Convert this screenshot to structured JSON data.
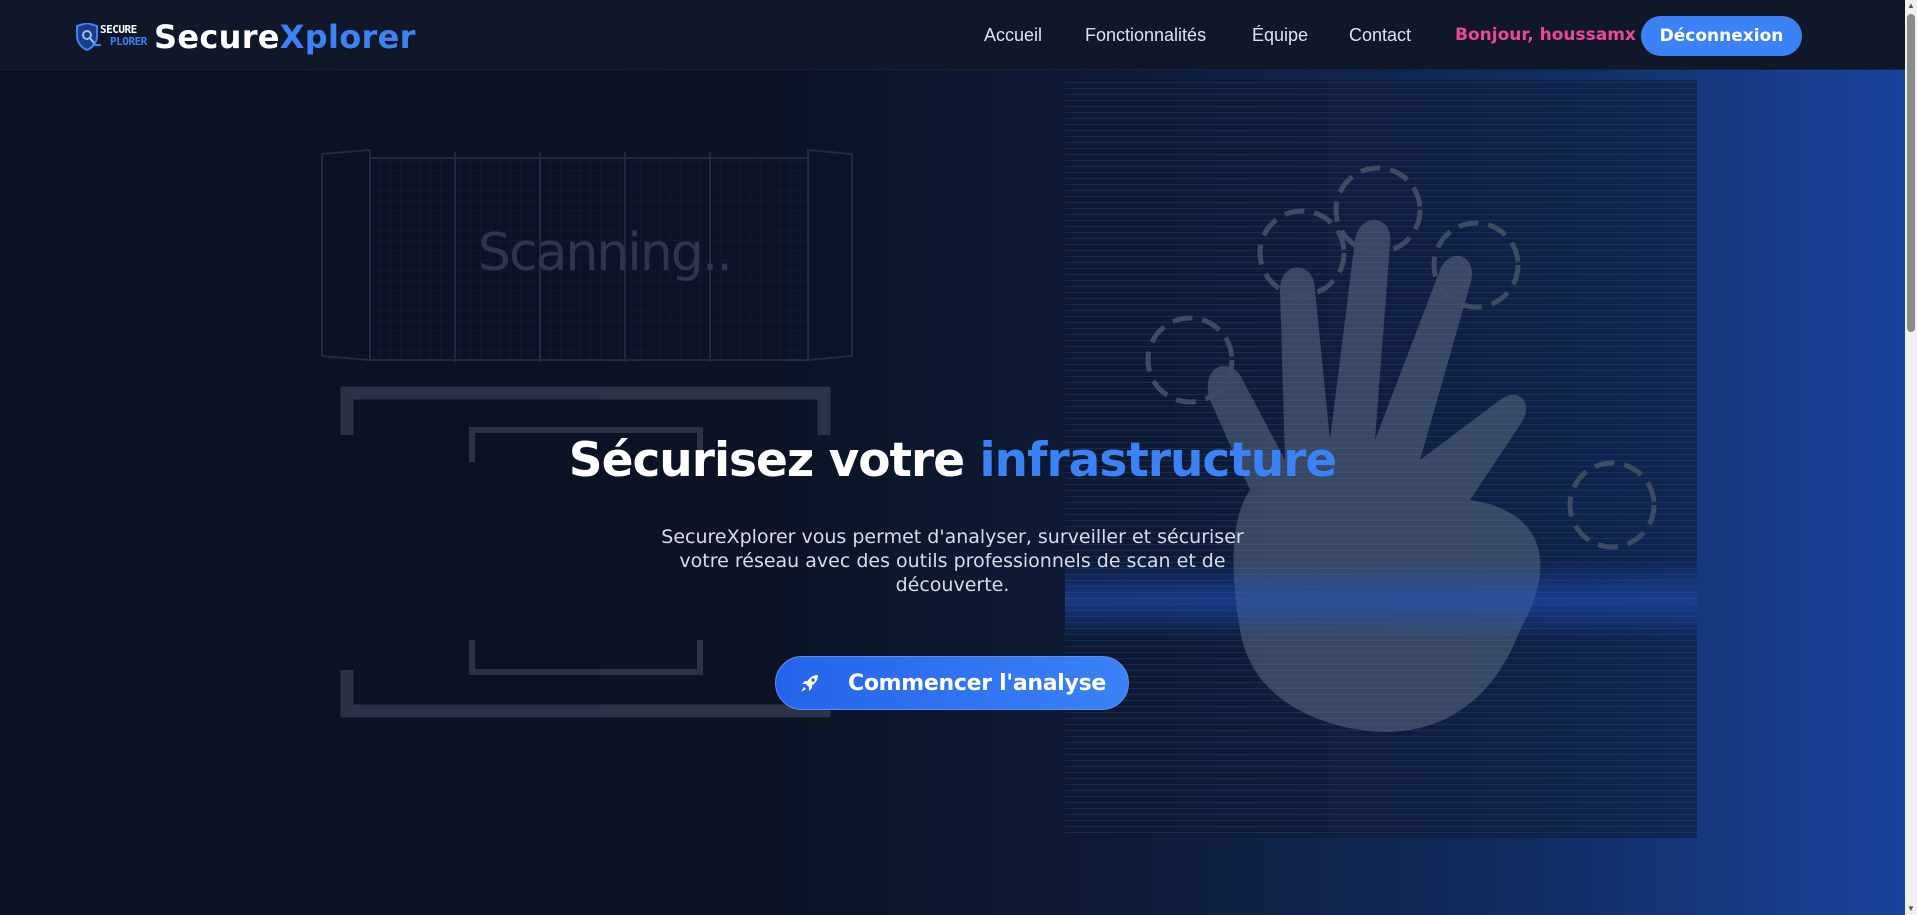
{
  "brand": {
    "logo_line1": "SECURE",
    "logo_line2": "PLORER",
    "name_part1": "Secure",
    "name_part2": "Xplorer"
  },
  "nav": {
    "links": [
      "Accueil",
      "Fonctionnalités",
      "Équipe",
      "Contact"
    ],
    "greeting": "Bonjour, houssamx",
    "logout_label": "Déconnexion"
  },
  "hero": {
    "title_part1": "Sécurisez votre ",
    "title_part2": "infrastructure",
    "subtitle": "SecureXplorer vous permet d'analyser, surveiller et sécuriser votre réseau avec des outils professionnels de scan et de découverte.",
    "cta_label": "Commencer l'analyse",
    "bg_scan_text": "Scanning.."
  },
  "colors": {
    "accent": "#3b82f6",
    "greeting": "#ec4899",
    "nav_bg": "#0f1729"
  }
}
